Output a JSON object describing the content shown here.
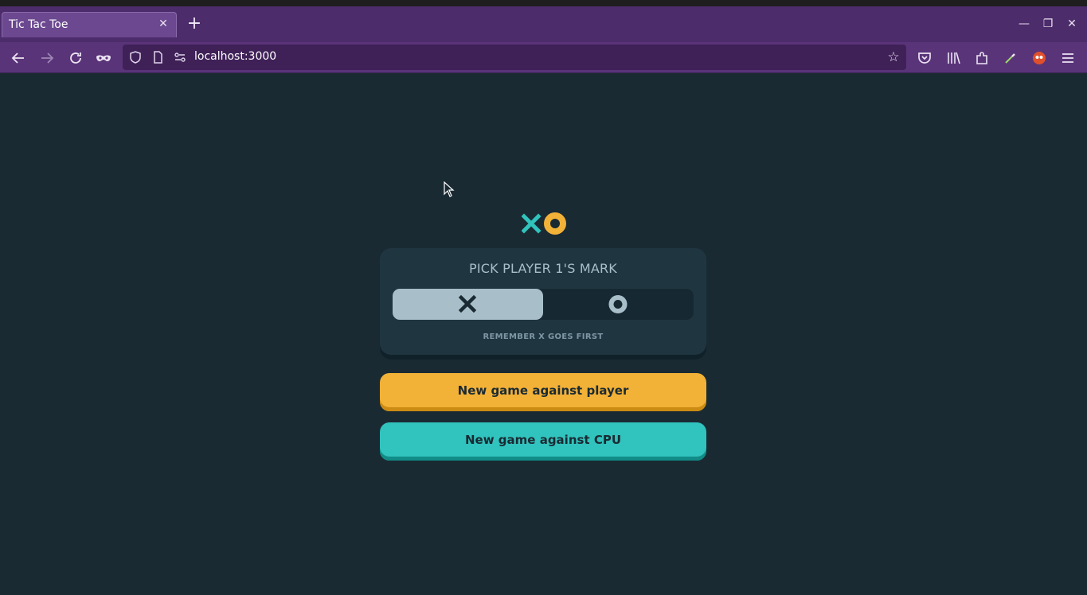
{
  "browser": {
    "tab_title": "Tic Tac Toe",
    "tab_close_icon": "close-icon",
    "new_tab_icon": "plus-icon",
    "url": "localhost:3000",
    "window_controls": [
      "minimize-icon",
      "restore-icon",
      "close-icon"
    ],
    "nav_icons": [
      "back-arrow-icon",
      "forward-arrow-icon",
      "reload-icon",
      "private-mask-icon"
    ],
    "toolbar_icons": [
      "pocket-icon",
      "library-icon",
      "extensions-icon",
      "eyedropper-icon",
      "addon-icon",
      "menu-icon"
    ]
  },
  "colors": {
    "background": "#1a2a33",
    "card": "#1f3641",
    "teal": "#31c3bd",
    "yellow": "#f2b137",
    "silver": "#a8bfc9"
  },
  "game": {
    "card_title": "PICK PLAYER 1'S MARK",
    "selected_mark": "X",
    "options": [
      "X",
      "O"
    ],
    "hint": "REMEMBER X GOES FIRST",
    "btn_vs_player": "New game against player",
    "btn_vs_cpu": "New game against CPU"
  }
}
